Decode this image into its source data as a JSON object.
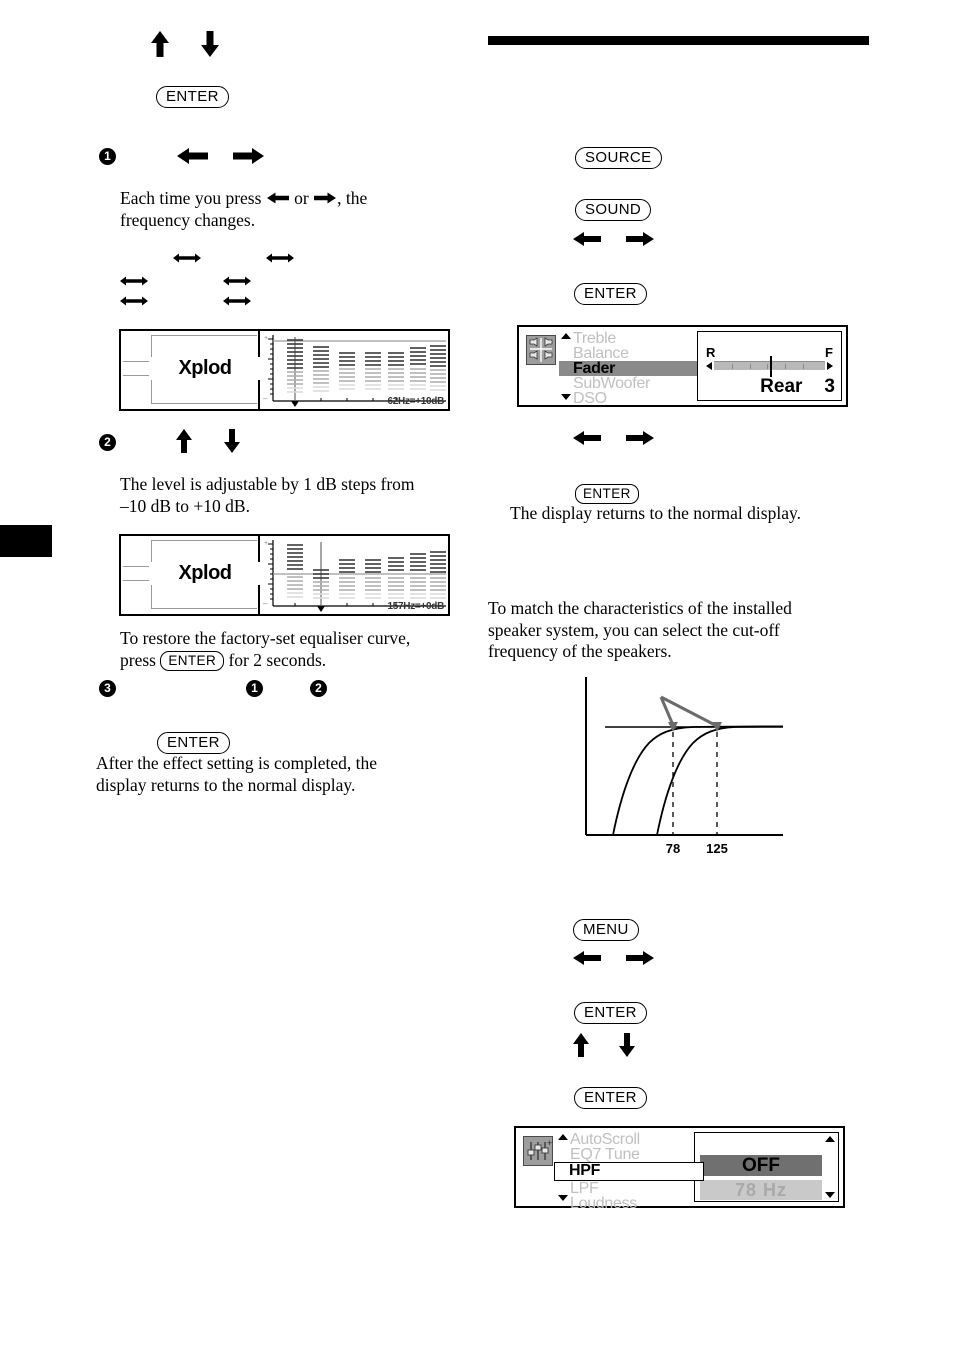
{
  "page": {
    "tab_marker": "black-page-tab",
    "heading_rule": "black-section-rule"
  },
  "left_column": {
    "step_enter_button": "ENTER",
    "step1_num": "1",
    "step1_body": "Each time you press ← or →, the frequency changes.",
    "step2_num": "2",
    "step2_body_line1": "The level is adjustable by 1 dB steps from",
    "step2_body_line2": "–10 dB to +10 dB.",
    "restore_line1": "To restore the factory-set equaliser curve,",
    "restore_press": "press",
    "restore_enter": "ENTER",
    "restore_tail": "for 2 seconds.",
    "step3_num": "3",
    "step3_ref1": "1",
    "step3_ref2": "2",
    "final_enter": "ENTER",
    "final_body_line1": "After the effect setting is completed, the",
    "final_body_line2": "display returns to the normal display."
  },
  "eq_display_1": {
    "brand_label": "Xplod",
    "readout": "62Hz=+10dB",
    "plus_label": "+",
    "minus_label": "–"
  },
  "eq_display_2": {
    "brand_label": "Xplod",
    "readout": "157Hz=+0dB",
    "plus_label": "+",
    "minus_label": "–"
  },
  "right_column": {
    "source_button": "SOURCE",
    "sound_button": "SOUND",
    "enter_button_1": "ENTER",
    "enter_button_2": "ENTER",
    "return_text": "The display returns to the normal display.",
    "intro_line1": "To match the characteristics of the installed",
    "intro_line2": "speaker system, you can select the cut-off",
    "intro_line3": "frequency of the speakers.",
    "menu_button": "MENU",
    "enter_button_3": "ENTER",
    "enter_button_4": "ENTER"
  },
  "fader_display": {
    "icon": "speaker-fader-icon",
    "items": [
      {
        "label": "Treble",
        "state": "dim"
      },
      {
        "label": "Balance",
        "state": "dim"
      },
      {
        "label": "Fader",
        "state": "selected"
      },
      {
        "label": "SubWoofer",
        "state": "dim"
      },
      {
        "label": "DSO",
        "state": "dim"
      }
    ],
    "slider_left_label": "R",
    "slider_right_label": "F",
    "readout_label": "Rear",
    "readout_value": "3"
  },
  "hpf_display": {
    "icon": "equalizer-settings-icon",
    "items": [
      {
        "label": "AutoScroll",
        "state": "dim"
      },
      {
        "label": "EQ7 Tune",
        "state": "dim"
      },
      {
        "label": "HPF",
        "state": "selected"
      },
      {
        "label": "LPF",
        "state": "dim"
      },
      {
        "label": "Loudness",
        "state": "dim"
      }
    ],
    "value_selected": "OFF",
    "value_next": "78  Hz"
  },
  "chart_data": {
    "type": "line",
    "title": "",
    "xlabel": "",
    "ylabel": "",
    "tick_labels": [
      "78",
      "125"
    ],
    "series": [
      {
        "name": "cut-off 78 Hz",
        "cutoff": 78
      },
      {
        "name": "cut-off 125 Hz",
        "cutoff": 125
      }
    ],
    "annotation_arrows": 2,
    "grid": false,
    "legend": "none"
  },
  "icons": {
    "arrow_up": "arrow-up-icon",
    "arrow_down": "arrow-down-icon",
    "arrow_left": "arrow-left-icon",
    "arrow_right": "arrow-right-icon",
    "arrow_lr": "arrow-left-right-icon"
  }
}
